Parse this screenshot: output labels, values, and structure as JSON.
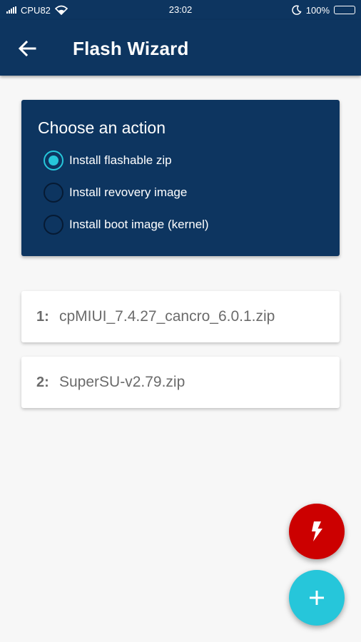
{
  "statusbar": {
    "carrier": "CPU82",
    "time": "23:02",
    "battery": "100%"
  },
  "appbar": {
    "title": "Flash Wizard",
    "back_icon": "arrow-left-icon"
  },
  "action_card": {
    "title": "Choose an action",
    "options": [
      {
        "label": "Install flashable zip",
        "checked": true
      },
      {
        "label": "Install revovery image",
        "checked": false
      },
      {
        "label": "Install boot image (kernel)",
        "checked": false
      }
    ]
  },
  "files": [
    {
      "index": "1:",
      "name": "cpMIUI_7.4.27_cancro_6.0.1.zip"
    },
    {
      "index": "2:",
      "name": "SuperSU-v2.79.zip"
    }
  ],
  "fabs": {
    "flash_icon": "lightning-bolt-icon",
    "add_icon": "plus-icon"
  },
  "colors": {
    "primary": "#0d3560",
    "accent": "#26c6da",
    "flash_button": "#cc0000",
    "background": "#f7f7f7"
  }
}
